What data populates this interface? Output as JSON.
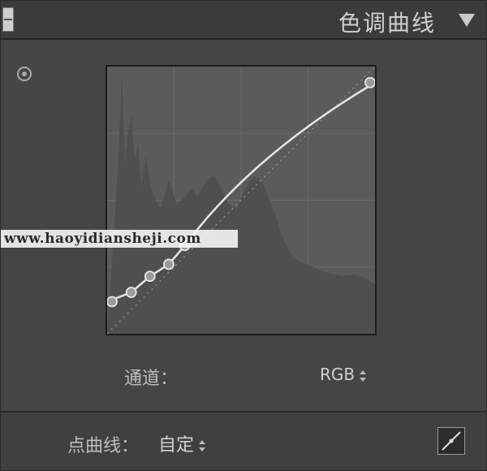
{
  "panel": {
    "title": "色调曲线",
    "watermark": "www.haoyidiansheji.com"
  },
  "channel": {
    "label": "通道：",
    "value": "RGB"
  },
  "point_curve": {
    "label": "点曲线：",
    "value": "自定"
  },
  "curve": {
    "points": [
      [
        0.0,
        0.12
      ],
      [
        0.09,
        0.155
      ],
      [
        0.16,
        0.215
      ],
      [
        0.23,
        0.26
      ],
      [
        0.29,
        0.33
      ],
      [
        1.0,
        0.94
      ]
    ]
  },
  "icons": {
    "collapse": "triangle-down-icon",
    "target": "target-adjustment-icon",
    "linear": "linear-curve-icon",
    "stepper": "up-down-stepper-icon"
  },
  "colors": {
    "panel_bg": "#454545",
    "curve_bg": "#5b5b5b",
    "histogram": "#4f4f4f",
    "curve_line": "#e6e6e6",
    "grid": "#6a6a6a"
  }
}
